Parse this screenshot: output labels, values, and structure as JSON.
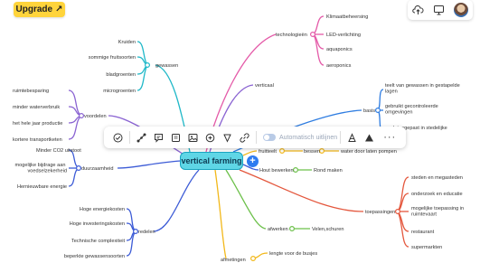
{
  "header": {
    "upgrade_label": "Upgrade",
    "upgrade_icon": "arrow-up-right-icon",
    "icons": [
      "cloud-upload-icon",
      "presentation-icon",
      "avatar"
    ]
  },
  "toolbar": {
    "icons": [
      "check-circle-icon",
      "connect-icon",
      "comment-icon",
      "note-icon",
      "image-icon",
      "link-icon",
      "shape-icon",
      "hyperlink-icon"
    ],
    "auto_label": "Automatisch uitlijnen",
    "icons_right": [
      "style-icon",
      "warning-icon"
    ],
    "more_label": "···"
  },
  "mindmap": {
    "center": "vertical farming",
    "add_label": "+",
    "nodes": {
      "technologieen": "technologieën",
      "klimaat": "Klimaatbeheersing",
      "led": "LED-verlichting",
      "aqua": "aquaponics",
      "aero": "aeroponics",
      "verticaal": "verticaal",
      "basis": "basis",
      "basis1": "teelt van gewassen in gestapelde lagen",
      "basis2": "gebruikt gecontroleerde omgevingen",
      "basis3": "vaak toegepast in stedelijke gebieden",
      "gewassen": "gewassen",
      "kruiden": "Kruiden",
      "fruit": "sommige fruitsoorten",
      "blad": "bladgroenten",
      "micro": "microgroenten",
      "voordelen": "voordelen",
      "ruimte": "ruimtebesparing",
      "water": "minder waterverbruik",
      "jaar": "het hele jaar productie",
      "transport": "kortere transportketen",
      "co2": "Minder CO2 uitstoot",
      "duurzaamheid": "duurzaamheid",
      "bijdrage": "mogelijke bijdrage aan voedselzekerheid",
      "hernieuw": "Hernieuwbare energie",
      "fruitteelt": "fruitteelt",
      "bessen": "bessen",
      "water_pompen": "water door laten pompen",
      "hout": "Hout bewerken",
      "rond": "Rond maken",
      "toepassingen": "toepassingen",
      "steden": "steden en megasteden",
      "onderzoek": "onderzoek en educatie",
      "ruimtevaart": "mogelijke toepassing in ruimtevaart",
      "restaurant": "restaurant",
      "super": "supermarkten",
      "redelen": "redelen",
      "energie": "Hoge energiekosten",
      "invest": "Hoge investeringskosten",
      "complex": "Technische complexiteit",
      "beperkte": "beperkte gewassensoorten",
      "afwerken": "afwerken",
      "velen": "Velen,schuren",
      "afmetingen": "afmetingen",
      "lengte": "lengte voor de busjes"
    }
  }
}
